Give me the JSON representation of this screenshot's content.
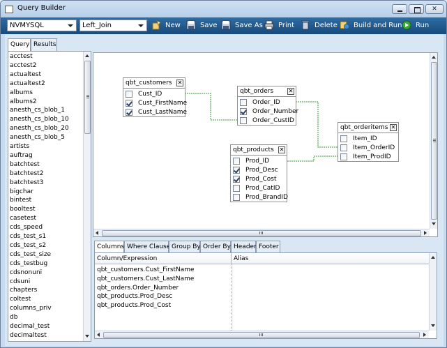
{
  "window": {
    "title": "Query Builder"
  },
  "toolbar": {
    "database": "NVMYSQL",
    "join_type": "Left_Join",
    "new_label": "New",
    "save_label": "Save",
    "save_as_label": "Save As",
    "print_label": "Print",
    "delete_label": "Delete",
    "build_run_label": "Build and Run",
    "run_label": "Run"
  },
  "left_tabs": [
    "Query",
    "Results"
  ],
  "tables": [
    "acctest",
    "acctest2",
    "actualtest",
    "actualtest2",
    "albums",
    "albums2",
    "anesth_cs_blob_1",
    "anesth_cs_blob_10",
    "anesth_cs_blob_20",
    "anesth_cs_blob_5",
    "artists",
    "auftrag",
    "batchtest",
    "batchtest2",
    "batchtest3",
    "bigchar",
    "bintest",
    "booltest",
    "casetest",
    "cds_speed",
    "cds_test_s1",
    "cds_test_s2",
    "cds_test_size",
    "cds_testbug",
    "cdsnonuni",
    "cdsuni",
    "chapters",
    "coltest",
    "columns_priv",
    "db",
    "decimal_test",
    "decimaltest"
  ],
  "designer": {
    "boxes": [
      {
        "name": "qbt_customers",
        "fields": [
          {
            "name": "Cust_ID",
            "checked": false
          },
          {
            "name": "Cust_FirstName",
            "checked": true
          },
          {
            "name": "Cust_LastName",
            "checked": true
          }
        ]
      },
      {
        "name": "qbt_orders",
        "fields": [
          {
            "name": "Order_ID",
            "checked": false
          },
          {
            "name": "Order_Number",
            "checked": true
          },
          {
            "name": "Order_CustID",
            "checked": false
          }
        ]
      },
      {
        "name": "qbt_orderitems",
        "fields": [
          {
            "name": "Item_ID",
            "checked": false
          },
          {
            "name": "Item_OrderID",
            "checked": false
          },
          {
            "name": "Item_ProdID",
            "checked": false
          }
        ]
      },
      {
        "name": "qbt_products",
        "fields": [
          {
            "name": "Prod_ID",
            "checked": false
          },
          {
            "name": "Prod_Desc",
            "checked": true
          },
          {
            "name": "Prod_Cost",
            "checked": true
          },
          {
            "name": "Prod_CatID",
            "checked": false
          },
          {
            "name": "Prod_BrandID",
            "checked": false
          }
        ]
      }
    ]
  },
  "bottom_tabs": [
    "Columns",
    "Where Clause",
    "Group By",
    "Order By",
    "Header",
    "Footer"
  ],
  "columns_grid": {
    "headers": [
      "Column/Expression",
      "Alias"
    ],
    "rows": [
      "qbt_customers.Cust_FirstName",
      "qbt_customers.Cust_LastName",
      "qbt_orders.Order_Number",
      "qbt_products.Prod_Desc",
      "qbt_products.Prod_Cost"
    ]
  },
  "colors": {
    "toolbar": "#1f5a91",
    "link_line": "#2e9a2e",
    "canvas": "#ffffff"
  }
}
